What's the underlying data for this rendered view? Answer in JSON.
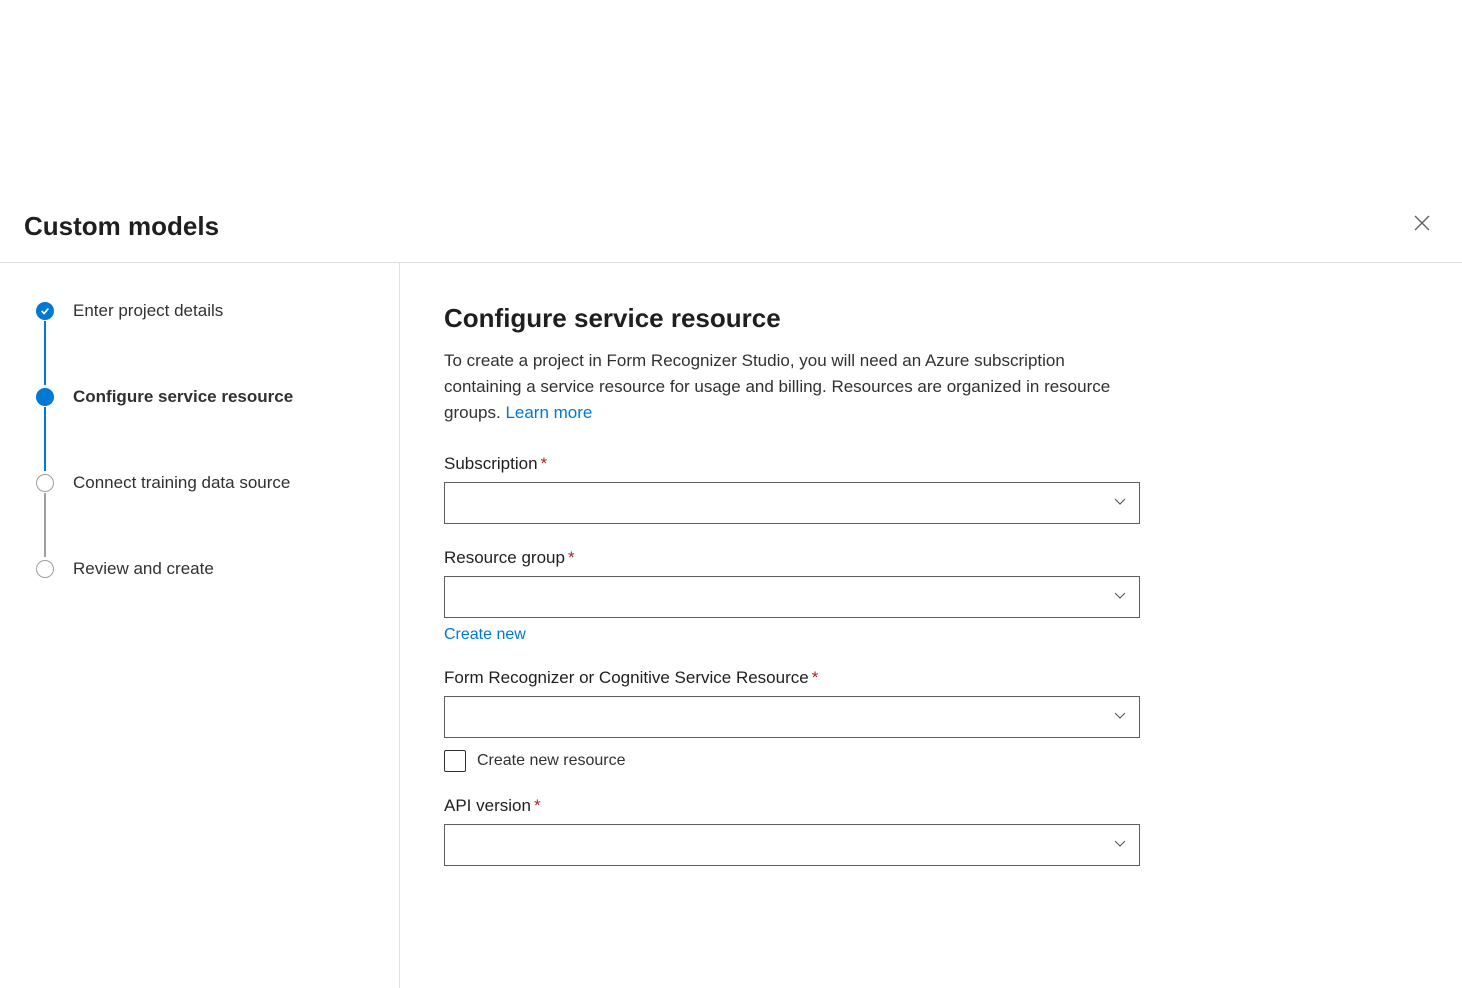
{
  "header": {
    "title": "Custom models"
  },
  "steps": {
    "items": [
      {
        "label": "Enter project details",
        "status": "completed"
      },
      {
        "label": "Configure service resource",
        "status": "active"
      },
      {
        "label": "Connect training data source",
        "status": "pending"
      },
      {
        "label": "Review and create",
        "status": "pending"
      }
    ]
  },
  "main": {
    "title": "Configure service resource",
    "description": "To create a project in Form Recognizer Studio, you will need an Azure subscription containing a service resource for usage and billing. Resources are organized in resource groups. ",
    "learn_more_label": "Learn more"
  },
  "form": {
    "subscription": {
      "label": "Subscription",
      "value": ""
    },
    "resource_group": {
      "label": "Resource group",
      "value": "",
      "create_new_label": "Create new"
    },
    "service_resource": {
      "label": "Form Recognizer or Cognitive Service Resource",
      "value": "",
      "checkbox_label": "Create new resource",
      "checked": false
    },
    "api_version": {
      "label": "API version",
      "value": ""
    }
  }
}
